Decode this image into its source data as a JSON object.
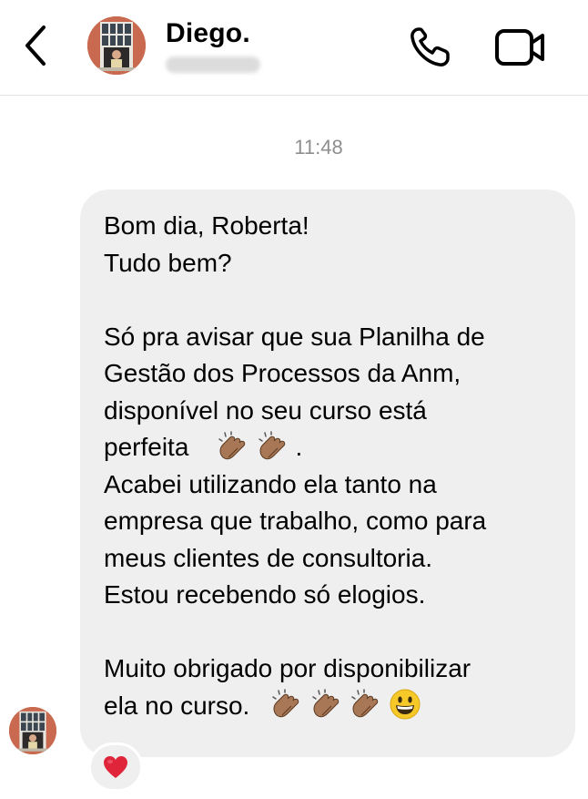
{
  "header": {
    "back_icon": "chevron-left-icon",
    "contact_name": "Diego.",
    "phone_icon": "phone-icon",
    "video_icon": "video-camera-icon"
  },
  "conversation": {
    "timestamp": "11:48",
    "message": {
      "lines": [
        "Bom dia, Roberta!",
        "Tudo bem?",
        "",
        "Só pra avisar que sua Planilha de",
        "Gestão dos Processos da Anm,",
        "disponível no seu curso está",
        "perfeita",
        "Acabei utilizando ela tanto na",
        "empresa que trabalho, como para",
        "meus clientes de consultoria.",
        "Estou recebendo só elogios.",
        "",
        "Muito obrigado por disponibilizar",
        "ela no curso."
      ],
      "perfeita_suffix": ".",
      "emojis": {
        "line7": [
          "clapping-hands-emoji",
          "clapping-hands-emoji"
        ],
        "line14": [
          "clapping-hands-emoji",
          "clapping-hands-emoji",
          "clapping-hands-emoji",
          "grinning-face-emoji"
        ]
      }
    },
    "reaction": {
      "emoji": "red-heart-emoji",
      "color": "#e0243a"
    }
  },
  "colors": {
    "bubble_bg": "#efefef",
    "timestamp": "#8e8e8e",
    "divider": "#e2e2e2"
  }
}
